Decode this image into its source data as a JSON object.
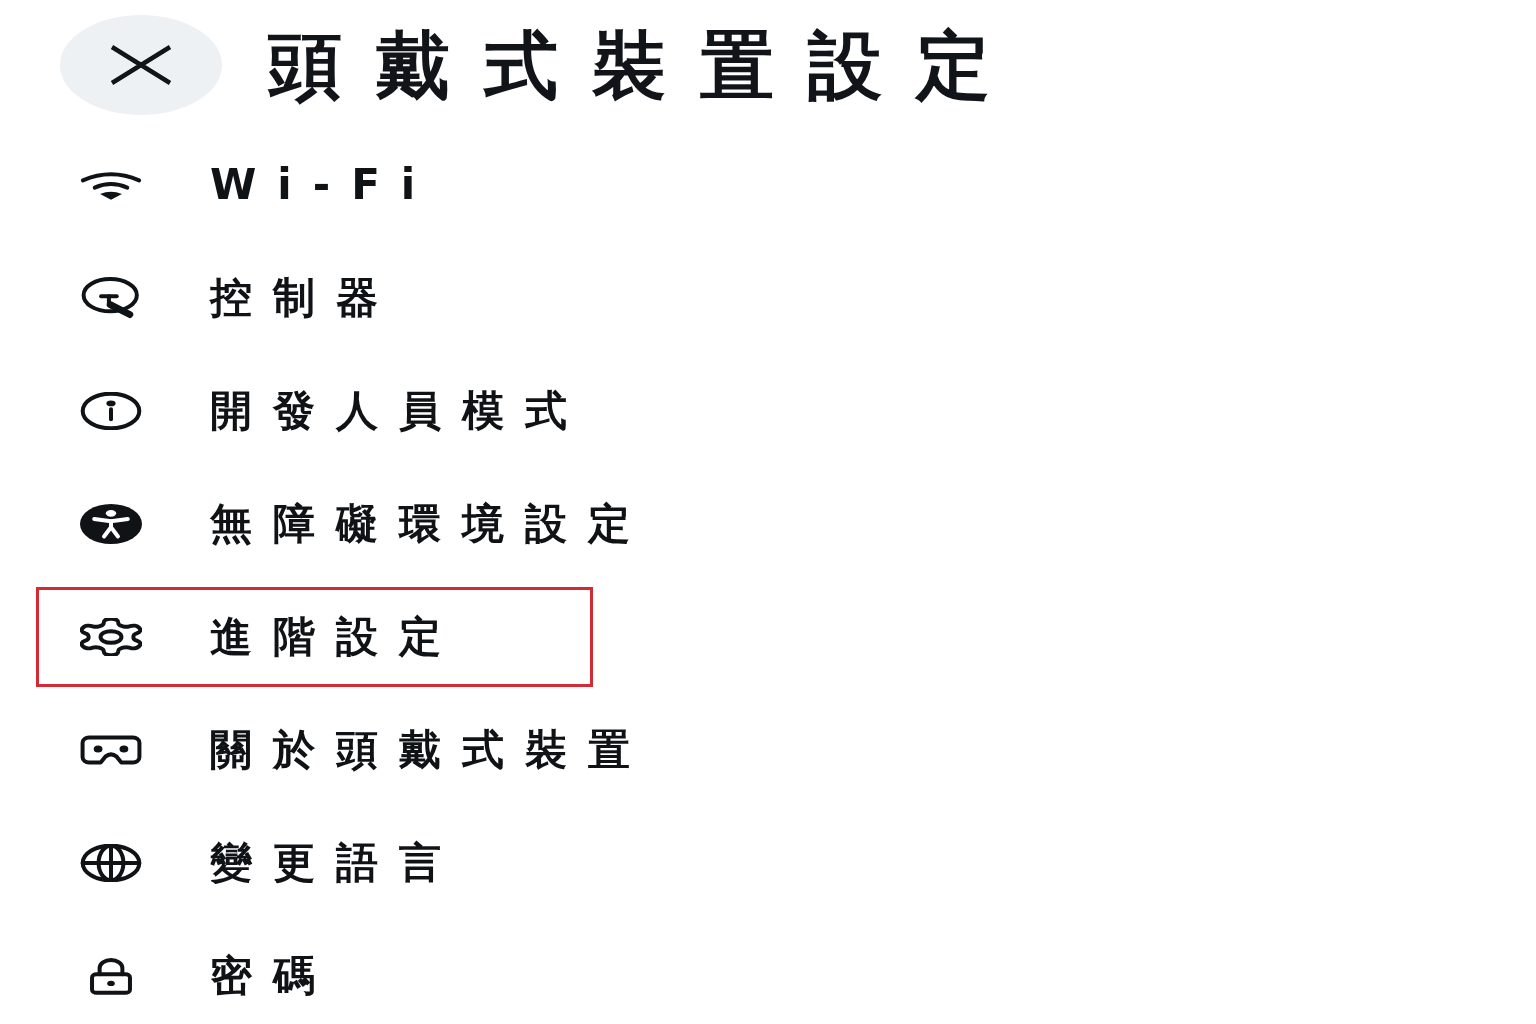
{
  "header": {
    "title": "頭戴式裝置設定"
  },
  "items": [
    {
      "label": "Wi-Fi",
      "highlighted": false
    },
    {
      "label": "控制器",
      "highlighted": false
    },
    {
      "label": "開發人員模式",
      "highlighted": false
    },
    {
      "label": "無障礙環境設定",
      "highlighted": false
    },
    {
      "label": "進階設定",
      "highlighted": true
    },
    {
      "label": "關於頭戴式裝置",
      "highlighted": false
    },
    {
      "label": "變更語言",
      "highlighted": false
    },
    {
      "label": "密碼",
      "highlighted": false
    }
  ]
}
